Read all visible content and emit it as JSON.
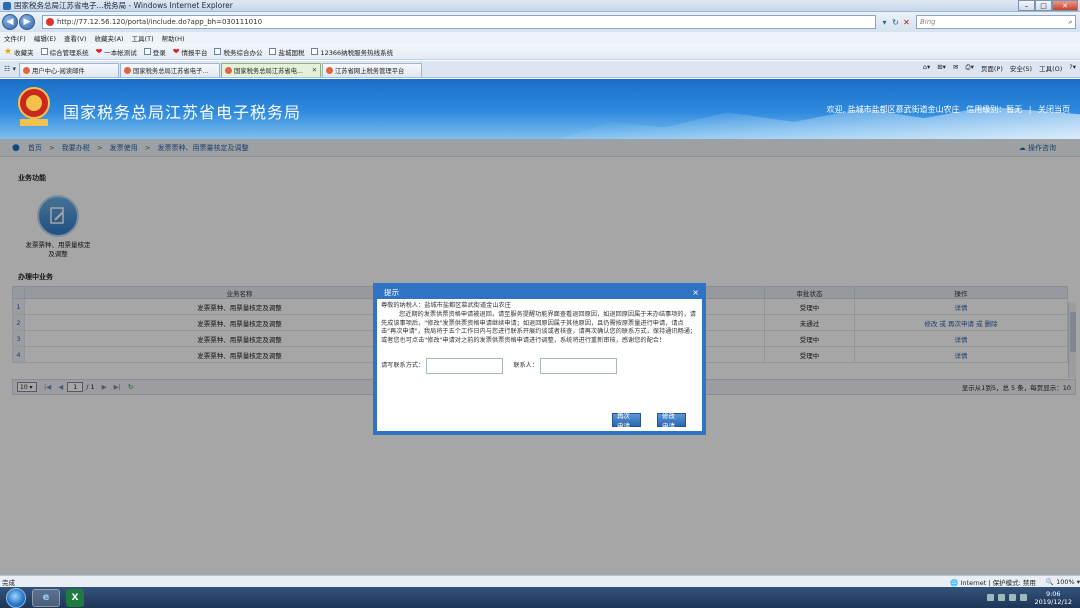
{
  "window": {
    "title": "国家税务总局江苏省电子...税务局 - Windows Internet Explorer"
  },
  "addressbar": {
    "url": "http://77.12.56.120/portal/include.do?app_bh=030111010",
    "search_placeholder": "Bing"
  },
  "menu": [
    "文件(F)",
    "编辑(E)",
    "查看(V)",
    "收藏夹(A)",
    "工具(T)",
    "帮助(H)"
  ],
  "favorites": [
    "收藏夹",
    "综合管理系统",
    "一本帐测试",
    "登录",
    "情报平台",
    "税务综合办公",
    "盐城国税",
    "12366纳税服务热线系统"
  ],
  "tabs": [
    {
      "label": "用户中心-阅读邮件"
    },
    {
      "label": "国家税务总局江苏省电子..."
    },
    {
      "label": "国家税务总局江苏省电..."
    },
    {
      "label": "江苏省网上税务管理平台"
    }
  ],
  "toolbar": {
    "page": "页面(P)",
    "safety": "安全(S)",
    "tools": "工具(O)"
  },
  "banner": {
    "title": "国家税务总局江苏省电子税务局",
    "welcome": "欢迎, 盐城市盐都区慕武街道金山农庄",
    "credit": "信用级别：暂无",
    "close": "关闭当页"
  },
  "breadcrumb": {
    "items": [
      "首页",
      "我要办税",
      "发票使用",
      "发票票种、用票量核定及调整"
    ],
    "help": "操作咨询"
  },
  "business": {
    "heading": "业务功能",
    "func_label": "发票票种、用票量核定及调整"
  },
  "inprogress": {
    "heading": "办理中业务",
    "columns": [
      "业务名称",
      "审批状态",
      "操作"
    ],
    "rows": [
      {
        "num": "1",
        "name": "发票票种、用票量核定及调整",
        "status": "受理中",
        "action": "详情",
        "act2": "",
        "act3": ""
      },
      {
        "num": "2",
        "name": "发票票种、用票量核定及调整",
        "status": "未通过",
        "action": "修改 或 再次申请 或 删除",
        "act2": "",
        "act3": ""
      },
      {
        "num": "3",
        "name": "发票票种、用票量核定及调整",
        "status": "受理中",
        "action": "详情",
        "act2": "",
        "act3": ""
      },
      {
        "num": "4",
        "name": "发票票种、用票量核定及调整",
        "status": "受理中",
        "action": "详情",
        "act2": "",
        "act3": ""
      }
    ]
  },
  "pager": {
    "size": "10",
    "page": "1",
    "total_pages": "/ 1",
    "info": "显示从1到5，总 5 条，每页显示：10"
  },
  "dialog": {
    "title": "提示",
    "greeting": "尊敬的纳税人：盐城市盐都区慕武街道金山农庄",
    "body": "您近期的发票供票资格申请被退回，请至服务提醒功能界面查看退回原因，如退回原因属于未办结事项的，请先成该事项后，\"修改\"发票供票资格申请继续申请；如退回原因属于其他原因，且仍需按原票量进行申请，请点击\"再次申请\"，我局将于五个工作日内与您进行联系开展约谈或者核查，请再次确认您的联系方式，保持通讯畅通；或者您也可点击\"修改\"申请对之前的发票供票资格申请进行调整，系统将进行重新审核，感谢您的配合！",
    "phone_label": "请写联系方式：",
    "contact_label": "联系人：",
    "btn_reapply": "再次申请",
    "btn_modify": "修改申请"
  },
  "status": {
    "left": "完成",
    "zone": "Internet | 保护模式: 禁用",
    "zoom": "100%"
  },
  "taskbar": {
    "time": "9:06",
    "date": "2019/12/12"
  }
}
